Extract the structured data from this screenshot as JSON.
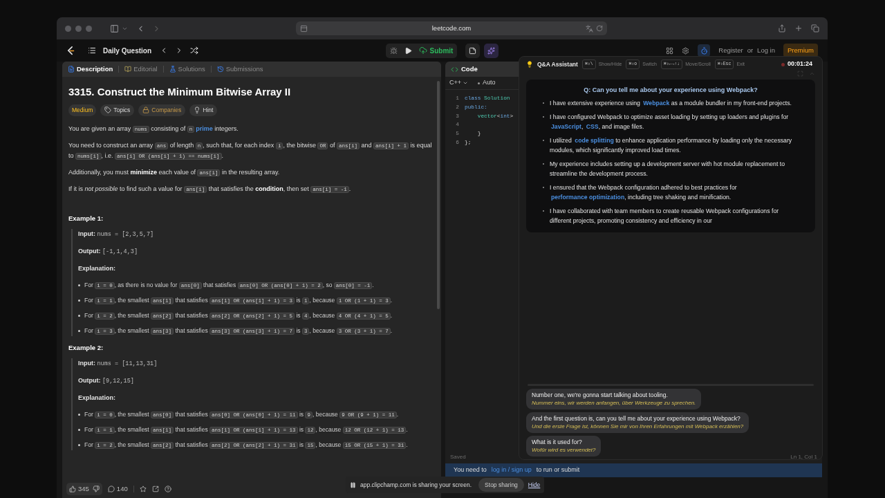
{
  "browser": {
    "url": "leetcode.com"
  },
  "nav": {
    "title": "Daily Question",
    "submit": "Submit",
    "register": "Register",
    "or": "or",
    "login": "Log in",
    "premium": "Premium"
  },
  "tabs": [
    {
      "label": "Description",
      "selected": true
    },
    {
      "label": "Editorial",
      "selected": false
    },
    {
      "label": "Solutions",
      "selected": false
    },
    {
      "label": "Submissions",
      "selected": false
    }
  ],
  "problem": {
    "title": "3315. Construct the Minimum Bitwise Array II",
    "difficulty": "Medium",
    "tags": [
      {
        "kind": "topics",
        "label": "Topics"
      },
      {
        "kind": "companies",
        "label": "Companies"
      },
      {
        "kind": "hint",
        "label": "Hint"
      }
    ],
    "paragraphs": [
      [
        {
          "kind": "text",
          "text": "You are given an array "
        },
        {
          "kind": "code",
          "text": "nums"
        },
        {
          "kind": "text",
          "text": " consisting of "
        },
        {
          "kind": "code",
          "text": "n"
        },
        {
          "kind": "link",
          "text": "prime"
        },
        {
          "kind": "text",
          "text": " integers."
        }
      ],
      [
        {
          "kind": "text",
          "text": "You need to construct an array "
        },
        {
          "kind": "code",
          "text": "ans"
        },
        {
          "kind": "text",
          "text": " of length "
        },
        {
          "kind": "code",
          "text": "n"
        },
        {
          "kind": "text",
          "text": ", such that, for each index "
        },
        {
          "kind": "code",
          "text": "i"
        },
        {
          "kind": "text",
          "text": ", the bitwise "
        },
        {
          "kind": "code",
          "text": "OR"
        },
        {
          "kind": "text",
          "text": " of "
        },
        {
          "kind": "code",
          "text": "ans[i]"
        },
        {
          "kind": "text",
          "text": " and "
        },
        {
          "kind": "code",
          "text": "ans[i] + 1"
        },
        {
          "kind": "text",
          "text": " is equal to "
        },
        {
          "kind": "code",
          "text": "nums[i]"
        },
        {
          "kind": "text",
          "text": ", i.e. "
        },
        {
          "kind": "code",
          "text": "ans[i] OR (ans[i] + 1) == nums[i]"
        },
        {
          "kind": "text",
          "text": "."
        }
      ],
      [
        {
          "kind": "text",
          "text": "Additionally, you must "
        },
        {
          "kind": "bold",
          "text": "minimize"
        },
        {
          "kind": "text",
          "text": " each value of "
        },
        {
          "kind": "code",
          "text": "ans[i]"
        },
        {
          "kind": "text",
          "text": " in the resulting array."
        }
      ],
      [
        {
          "kind": "text",
          "text": "If it is "
        },
        {
          "kind": "italic",
          "text": "not possible"
        },
        {
          "kind": "text",
          "text": " to find such a value for "
        },
        {
          "kind": "code",
          "text": "ans[i]"
        },
        {
          "kind": "text",
          "text": " that satisfies the "
        },
        {
          "kind": "bold",
          "text": "condition"
        },
        {
          "kind": "text",
          "text": ", then set "
        },
        {
          "kind": "code",
          "text": "ans[i] = -1"
        },
        {
          "kind": "text",
          "text": "."
        }
      ]
    ],
    "examples": [
      {
        "title": "Example 1:",
        "input_label": "Input:",
        "input": "nums = [2,3,5,7]",
        "output_label": "Output:",
        "output": "[-1,1,4,3]",
        "explanation_label": "Explanation:",
        "bullets": [
          [
            {
              "kind": "text",
              "text": "For "
            },
            {
              "kind": "code",
              "text": "i = 0"
            },
            {
              "kind": "text",
              "text": ", as there is no value for "
            },
            {
              "kind": "code",
              "text": "ans[0]"
            },
            {
              "kind": "text",
              "text": " that satisfies "
            },
            {
              "kind": "code",
              "text": "ans[0] OR (ans[0] + 1) = 2"
            },
            {
              "kind": "text",
              "text": ", so "
            },
            {
              "kind": "code",
              "text": "ans[0] = -1"
            },
            {
              "kind": "text",
              "text": "."
            }
          ],
          [
            {
              "kind": "text",
              "text": "For "
            },
            {
              "kind": "code",
              "text": "i = 1"
            },
            {
              "kind": "text",
              "text": ", the smallest "
            },
            {
              "kind": "code",
              "text": "ans[1]"
            },
            {
              "kind": "text",
              "text": " that satisfies "
            },
            {
              "kind": "code",
              "text": "ans[1] OR (ans[1] + 1) = 3"
            },
            {
              "kind": "text",
              "text": " is "
            },
            {
              "kind": "code",
              "text": "1"
            },
            {
              "kind": "text",
              "text": ", because "
            },
            {
              "kind": "code",
              "text": "1 OR (1 + 1) = 3"
            },
            {
              "kind": "text",
              "text": "."
            }
          ],
          [
            {
              "kind": "text",
              "text": "For "
            },
            {
              "kind": "code",
              "text": "i = 2"
            },
            {
              "kind": "text",
              "text": ", the smallest "
            },
            {
              "kind": "code",
              "text": "ans[2]"
            },
            {
              "kind": "text",
              "text": " that satisfies "
            },
            {
              "kind": "code",
              "text": "ans[2] OR (ans[2] + 1) = 5"
            },
            {
              "kind": "text",
              "text": " is "
            },
            {
              "kind": "code",
              "text": "4"
            },
            {
              "kind": "text",
              "text": ", because "
            },
            {
              "kind": "code",
              "text": "4 OR (4 + 1) = 5"
            },
            {
              "kind": "text",
              "text": "."
            }
          ],
          [
            {
              "kind": "text",
              "text": "For "
            },
            {
              "kind": "code",
              "text": "i = 3"
            },
            {
              "kind": "text",
              "text": ", the smallest "
            },
            {
              "kind": "code",
              "text": "ans[3]"
            },
            {
              "kind": "text",
              "text": " that satisfies "
            },
            {
              "kind": "code",
              "text": "ans[3] OR (ans[3] + 1) = 7"
            },
            {
              "kind": "text",
              "text": " is "
            },
            {
              "kind": "code",
              "text": "3"
            },
            {
              "kind": "text",
              "text": ", because "
            },
            {
              "kind": "code",
              "text": "3 OR (3 + 1) = 7"
            },
            {
              "kind": "text",
              "text": "."
            }
          ]
        ]
      },
      {
        "title": "Example 2:",
        "input_label": "Input:",
        "input": "nums = [11,13,31]",
        "output_label": "Output:",
        "output": "[9,12,15]",
        "explanation_label": "Explanation:",
        "bullets": [
          [
            {
              "kind": "text",
              "text": "For "
            },
            {
              "kind": "code",
              "text": "i = 0"
            },
            {
              "kind": "text",
              "text": ", the smallest "
            },
            {
              "kind": "code",
              "text": "ans[0]"
            },
            {
              "kind": "text",
              "text": " that satisfies "
            },
            {
              "kind": "code",
              "text": "ans[0] OR (ans[0] + 1) = 11"
            },
            {
              "kind": "text",
              "text": " is "
            },
            {
              "kind": "code",
              "text": "9"
            },
            {
              "kind": "text",
              "text": ", because "
            },
            {
              "kind": "code",
              "text": "9 OR (9 + 1) = 11"
            },
            {
              "kind": "text",
              "text": "."
            }
          ],
          [
            {
              "kind": "text",
              "text": "For "
            },
            {
              "kind": "code",
              "text": "i = 1"
            },
            {
              "kind": "text",
              "text": ", the smallest "
            },
            {
              "kind": "code",
              "text": "ans[1]"
            },
            {
              "kind": "text",
              "text": " that satisfies "
            },
            {
              "kind": "code",
              "text": "ans[1] OR (ans[1] + 1) = 13"
            },
            {
              "kind": "text",
              "text": " is "
            },
            {
              "kind": "code",
              "text": "12"
            },
            {
              "kind": "text",
              "text": ", because "
            },
            {
              "kind": "code",
              "text": "12 OR (12 + 1) = 13"
            },
            {
              "kind": "text",
              "text": "."
            }
          ],
          [
            {
              "kind": "text",
              "text": "For "
            },
            {
              "kind": "code",
              "text": "i = 2"
            },
            {
              "kind": "text",
              "text": ", the smallest "
            },
            {
              "kind": "code",
              "text": "ans[2]"
            },
            {
              "kind": "text",
              "text": " that satisfies "
            },
            {
              "kind": "code",
              "text": "ans[2] OR (ans[2] + 1) = 31"
            },
            {
              "kind": "text",
              "text": " is "
            },
            {
              "kind": "code",
              "text": "15"
            },
            {
              "kind": "text",
              "text": ", because "
            },
            {
              "kind": "code",
              "text": "15 OR (15 + 1) = 31"
            },
            {
              "kind": "text",
              "text": "."
            }
          ]
        ]
      }
    ]
  },
  "footer": {
    "likes": "345",
    "comments": "140"
  },
  "code": {
    "title": "Code",
    "language": "C++",
    "mode": "Auto",
    "lines": [
      {
        "number": "1",
        "segments": [
          {
            "kind": "keyword",
            "text": "class "
          },
          {
            "kind": "type",
            "text": "Solution"
          }
        ]
      },
      {
        "number": "2",
        "segments": [
          {
            "kind": "keyword",
            "text": "public:"
          }
        ]
      },
      {
        "number": "3",
        "segments": [
          {
            "kind": "type",
            "text": "    vector"
          },
          {
            "kind": "plain",
            "text": "<"
          },
          {
            "kind": "keyword",
            "text": "int"
          },
          {
            "kind": "plain",
            "text": ">"
          }
        ]
      },
      {
        "number": "4"
      },
      {
        "number": "5",
        "segments": [
          {
            "kind": "plain",
            "text": "    }"
          }
        ]
      },
      {
        "number": "6",
        "segments": [
          {
            "kind": "plain",
            "text": "};"
          }
        ]
      }
    ],
    "saved": "Saved",
    "cursor": "Ln 1, Col 1"
  },
  "login_bar": {
    "before": "You need to",
    "link": "log in / sign up",
    "after": "to run or submit"
  },
  "assistant": {
    "title": "Q&A Assistant",
    "shortcuts": [
      {
        "keys": "⌘⇧\\",
        "label": "Show/Hide"
      },
      {
        "keys": "⌘⇧o",
        "label": "Switch"
      },
      {
        "keys": "⌘⇧←→↑↓",
        "label": "Move/Scroll"
      },
      {
        "keys": "⌘⇧Esc",
        "label": "Exit"
      }
    ],
    "timer": "00:01:24",
    "question": "Q: Can you tell me about your experience using Webpack?",
    "answers": [
      [
        {
          "kind": "text",
          "text": "I have extensive experience using "
        },
        {
          "kind": "link",
          "text": "Webpack"
        },
        {
          "kind": "text",
          "text": " as a module bundler in my front-end projects."
        }
      ],
      [
        {
          "kind": "text",
          "text": "I have configured Webpack to optimize asset loading by setting up loaders and plugins for "
        },
        {
          "kind": "link",
          "text": "JavaScript"
        },
        {
          "kind": "text",
          "text": ", "
        },
        {
          "kind": "link",
          "text": "CSS"
        },
        {
          "kind": "text",
          "text": ", and image files."
        }
      ],
      [
        {
          "kind": "text",
          "text": "I utilized "
        },
        {
          "kind": "link",
          "text": "code splitting"
        },
        {
          "kind": "text",
          "text": " to enhance application performance by loading only the necessary modules, which significantly improved load times."
        }
      ],
      [
        {
          "kind": "text",
          "text": "My experience includes setting up a development server with hot module replacement to streamline the development process."
        }
      ],
      [
        {
          "kind": "text",
          "text": "I ensured that the Webpack configuration adhered to best practices for "
        },
        {
          "kind": "link",
          "text": "performance optimization"
        },
        {
          "kind": "text",
          "text": ", including tree shaking and minification."
        }
      ],
      [
        {
          "kind": "text",
          "text": "I have collaborated with team members to create reusable Webpack configurations for different projects, promoting consistency and efficiency in our"
        }
      ]
    ],
    "transcript": [
      {
        "text": "Number one, we're gonna start talking about tooling.",
        "translation": "Nummer eins, wir werden anfangen, über Werkzeuge zu sprechen."
      },
      {
        "text": "And the first question is, can you tell me about your experience using Webpack?",
        "translation": "Und die erste Frage ist, können Sie mir von Ihren Erfahrungen mit Webpack erzählen?"
      },
      {
        "text": "What is it used for?",
        "translation": "Wofür wird es verwendet?"
      }
    ]
  },
  "share_bar": {
    "message": "app.clipchamp.com is sharing your screen.",
    "stop": "Stop sharing",
    "hide": "Hide"
  }
}
